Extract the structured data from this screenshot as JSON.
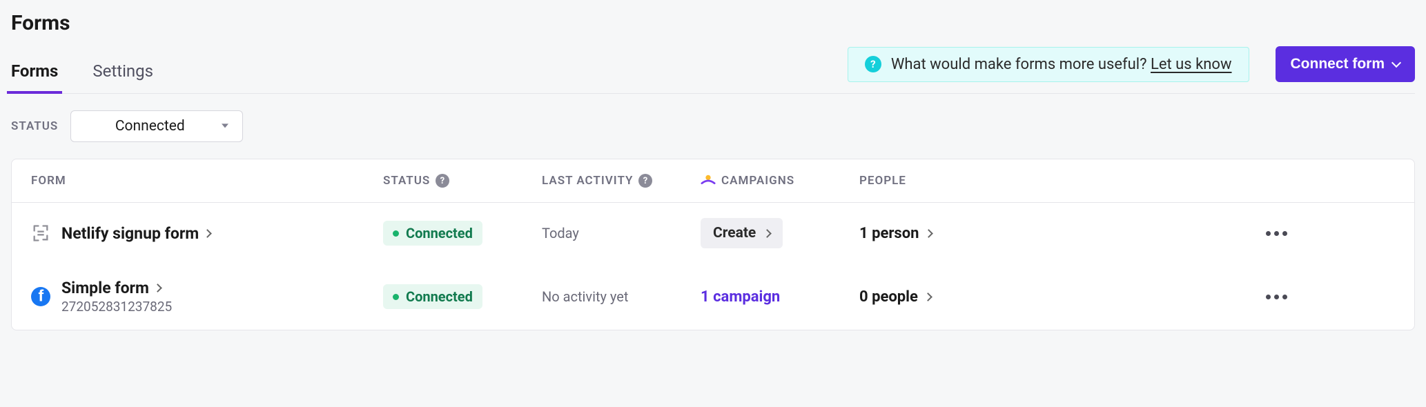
{
  "page": {
    "title": "Forms"
  },
  "tabs": {
    "forms": "Forms",
    "settings": "Settings"
  },
  "banner": {
    "text": "What would make forms more useful? ",
    "link": "Let us know"
  },
  "buttons": {
    "connect_form": "Connect form"
  },
  "filter": {
    "label": "STATUS",
    "value": "Connected"
  },
  "table": {
    "headers": {
      "form": "FORM",
      "status": "STATUS",
      "last_activity": "LAST ACTIVITY",
      "campaigns": "CAMPAIGNS",
      "people": "PEOPLE"
    },
    "rows": [
      {
        "icon": "form-icon",
        "name": "Netlify signup form",
        "subtext": "",
        "status": "Connected",
        "last_activity": "Today",
        "campaign_mode": "create",
        "campaign_label": "Create",
        "people": "1 person"
      },
      {
        "icon": "facebook-icon",
        "name": "Simple form",
        "subtext": "272052831237825",
        "status": "Connected",
        "last_activity": "No activity yet",
        "campaign_mode": "link",
        "campaign_label": "1 campaign",
        "people": "0 people"
      }
    ]
  }
}
